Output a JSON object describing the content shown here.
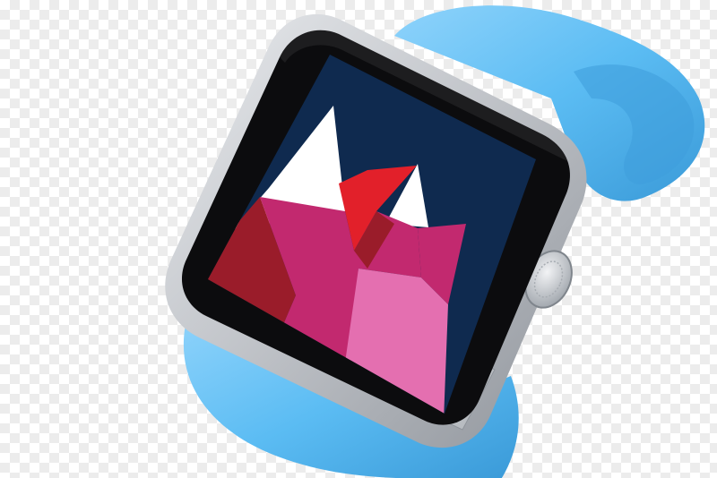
{
  "image": {
    "background": "transparency-checkerboard",
    "subject": "smartwatch-product-render"
  },
  "colors": {
    "checker_light": "#ffffff",
    "checker_dark": "#ececec",
    "band": "#5bbcf3",
    "band_shadow": "#3f9fdc",
    "case": "#c9ccd0",
    "bezel": "#0c0c0e",
    "wallpaper_sky": "#0f2a4f",
    "peak_white": "#ffffff",
    "peak_red": "#e2202a",
    "slope_dark_red": "#9a1c2a",
    "slope_magenta": "#c2296f",
    "slope_pink": "#e46fb0"
  },
  "icons": {
    "crown": "digital-crown-icon",
    "side_button": "side-button-icon"
  }
}
